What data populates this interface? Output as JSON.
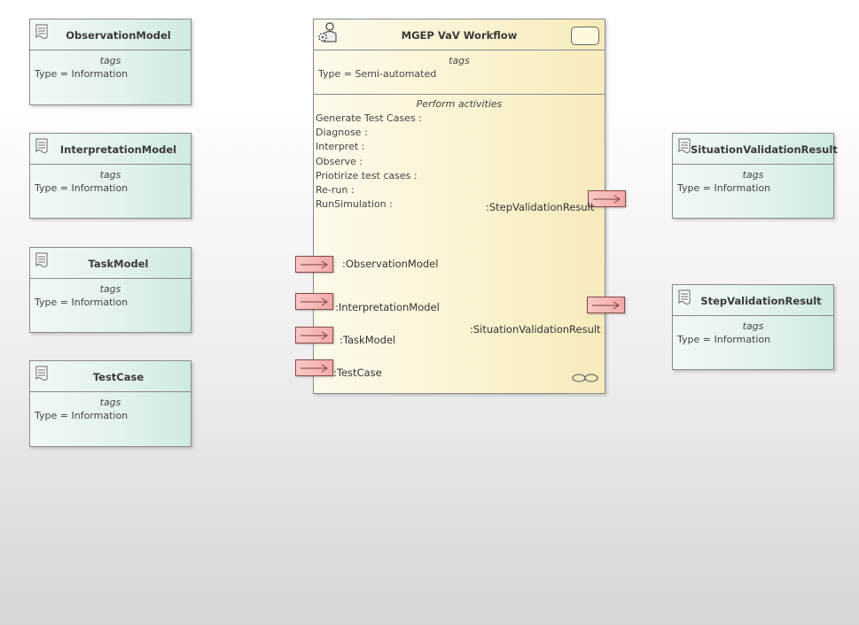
{
  "process": {
    "title": "MGEP VaV Workflow",
    "tags_heading": "tags",
    "type_prop": "Type = Semi-automated",
    "activities_heading": "Perform activities",
    "activities": [
      "Generate Test Cases :",
      "Diagnose :",
      "Interpret :",
      "Observe :",
      "Priotirize test cases :",
      "Re-run :",
      "RunSimulation :"
    ]
  },
  "input_pins": [
    {
      "label": ":ObservationModel"
    },
    {
      "label": ":InterpretationModel"
    },
    {
      "label": ":TaskModel"
    },
    {
      "label": ":TestCase"
    }
  ],
  "output_pins": [
    {
      "label": ":StepValidationResult"
    },
    {
      "label": ":SituationValidationResult"
    }
  ],
  "elements": [
    {
      "name": "ObservationModel",
      "tags_heading": "tags",
      "type_prop": "Type = Information"
    },
    {
      "name": "InterpretationModel",
      "tags_heading": "tags",
      "type_prop": "Type = Information"
    },
    {
      "name": "TaskModel",
      "tags_heading": "tags",
      "type_prop": "Type = Information"
    },
    {
      "name": "TestCase",
      "tags_heading": "tags",
      "type_prop": "Type = Information"
    },
    {
      "name": "SituationValidationResult",
      "tags_heading": "tags",
      "type_prop": "Type = Information"
    },
    {
      "name": "StepValidationResult",
      "tags_heading": "tags",
      "type_prop": "Type = Information"
    }
  ],
  "colors": {
    "element_fill": "#e3f2ee",
    "process_fill": "#fbf3d1",
    "pin_fill": "#f2a9a9"
  },
  "icons": {
    "element": "document-icon",
    "process": "actor-gear-icon",
    "process_corner": "rounded-rect-icon",
    "process_footer": "infinity-icon",
    "pin": "arrow-right-icon"
  }
}
